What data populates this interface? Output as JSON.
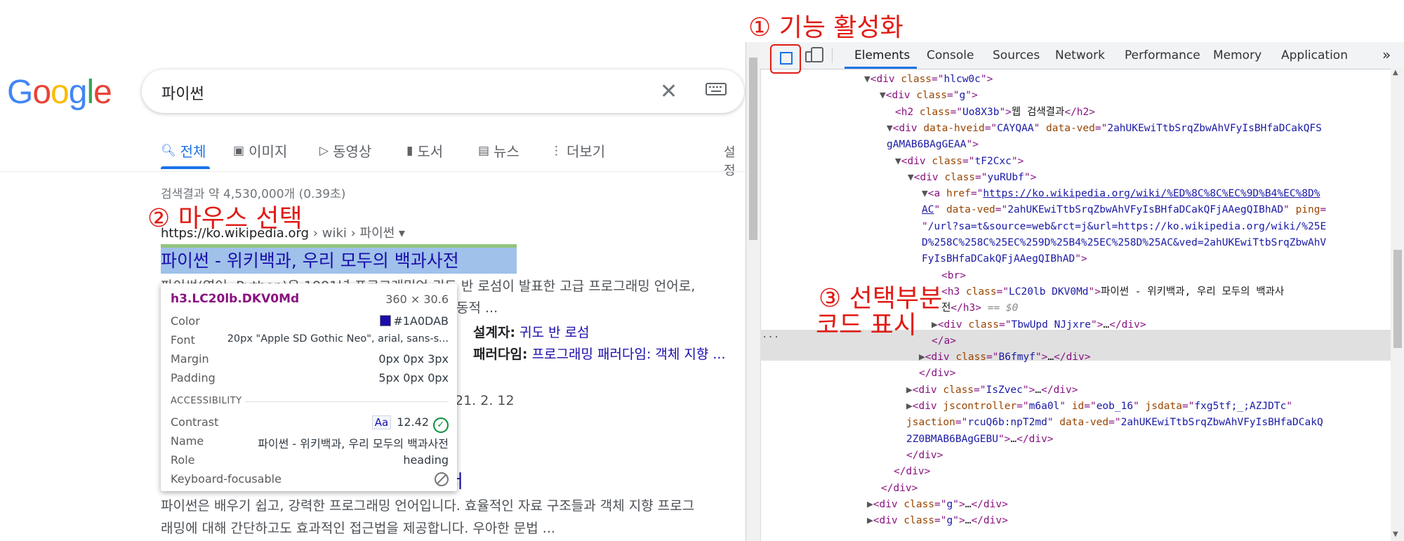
{
  "google": {
    "search_query": "파이썬",
    "tabs": [
      {
        "label": "전체",
        "icon": "search-icon"
      },
      {
        "label": "이미지",
        "icon": "image-icon"
      },
      {
        "label": "동영상",
        "icon": "video-icon"
      },
      {
        "label": "도서",
        "icon": "book-icon"
      },
      {
        "label": "뉴스",
        "icon": "news-icon"
      },
      {
        "label": "더보기",
        "icon": "more-dots-icon"
      }
    ],
    "settings_fragment": "설정",
    "result_stats": "검색결과 약 4,530,000개 (0.39초)",
    "result1": {
      "url_host": "https://ko.wikipedia.org",
      "url_path": " › wiki › 파이썬 ▾",
      "title": "파이썬 - 위키백과, 우리 모두의 백과사전",
      "snippet_l1": "파이썬(영어: Python)은 1991년 프로그래밍언 귀도 반 로섬이 발표한 고급 프로그래밍 언어로,",
      "snippet_l2": "동적 ...",
      "designer_label": "설계자:",
      "designer_value": "귀도 반 로섬",
      "paradigm_label": "패러다임:",
      "paradigm_value": "프로그래밍 패러다임: 객체 지향 ...",
      "date_fragment": "21. 2. 12"
    },
    "result2": {
      "title_fragment": "서",
      "snippet_l1": "파이썬은 배우기 쉽고, 강력한 프로그래밍 언어입니다. 효율적인 자료 구조들과 객체 지향 프로그",
      "snippet_l2": "래밍에 대해 간단하고도 효과적인 접근법을 제공합니다. 우아한 문법 ..."
    }
  },
  "tooltip": {
    "selector": "h3.LC20lb.DKV0Md",
    "size": "360 × 30.6",
    "rows": [
      {
        "key": "Color",
        "value": "#1A0DAB"
      },
      {
        "key": "Font",
        "value": "20px \"Apple SD Gothic Neo\", arial, sans-s..."
      },
      {
        "key": "Margin",
        "value": "0px 0px 3px"
      },
      {
        "key": "Padding",
        "value": "5px 0px 0px"
      }
    ],
    "accessibility_header": "ACCESSIBILITY",
    "acc_rows": [
      {
        "key": "Contrast",
        "value": "12.42"
      },
      {
        "key": "Name",
        "value": "파이썬 - 위키백과, 우리 모두의 백과사전"
      },
      {
        "key": "Role",
        "value": "heading"
      },
      {
        "key": "Keyboard-focusable",
        "value": ""
      }
    ],
    "contrast_badge": "Aa"
  },
  "annotations": {
    "step1": "① 기능 활성화",
    "step2": "② 마우스 선택",
    "step3_line1": "③ 선택부분",
    "step3_line2": "코드 표시"
  },
  "devtools": {
    "tabs": [
      "Elements",
      "Console",
      "Sources",
      "Network",
      "Performance",
      "Memory",
      "Application"
    ],
    "more": "»",
    "code_lines": [
      {
        "indent": 168,
        "parts": [
          [
            "tri",
            "▼"
          ],
          [
            "tag",
            "<div "
          ],
          [
            "an",
            "class"
          ],
          [
            "tag",
            "=\""
          ],
          [
            "av",
            "hlcw0c"
          ],
          [
            "tag",
            "\">"
          ]
        ]
      },
      {
        "indent": 190,
        "parts": [
          [
            "tri",
            "▼"
          ],
          [
            "tag",
            "<div "
          ],
          [
            "an",
            "class"
          ],
          [
            "tag",
            "=\""
          ],
          [
            "av",
            "g"
          ],
          [
            "tag",
            "\">"
          ]
        ]
      },
      {
        "indent": 212,
        "parts": [
          [
            "tag",
            "<h2 "
          ],
          [
            "an",
            "class"
          ],
          [
            "tag",
            "=\""
          ],
          [
            "av",
            "Uo8X3b"
          ],
          [
            "tag",
            "\">"
          ],
          [
            "txt",
            "웹 검색결과"
          ],
          [
            "tag",
            "</h2>"
          ]
        ]
      },
      {
        "indent": 200,
        "parts": [
          [
            "tri",
            "▼"
          ],
          [
            "tag",
            "<div "
          ],
          [
            "an",
            "data-hveid"
          ],
          [
            "tag",
            "=\""
          ],
          [
            "av",
            "CAYQAA"
          ],
          [
            "tag",
            "\" "
          ],
          [
            "an",
            "data-ved"
          ],
          [
            "tag",
            "=\""
          ],
          [
            "av",
            "2ahUKEwiTtbSrqZbwAhVFyIsBHfaDCakQFS"
          ]
        ]
      },
      {
        "indent": 200,
        "parts": [
          [
            "av",
            "gAMAB6BAgGEAA"
          ],
          [
            "tag",
            "\">"
          ]
        ]
      },
      {
        "indent": 212,
        "parts": [
          [
            "tri",
            "▼"
          ],
          [
            "tag",
            "<div "
          ],
          [
            "an",
            "class"
          ],
          [
            "tag",
            "=\""
          ],
          [
            "av",
            "tF2Cxc"
          ],
          [
            "tag",
            "\">"
          ]
        ]
      },
      {
        "indent": 230,
        "parts": [
          [
            "tri",
            "▼"
          ],
          [
            "tag",
            "<div "
          ],
          [
            "an",
            "class"
          ],
          [
            "tag",
            "=\""
          ],
          [
            "av",
            "yuRUbf"
          ],
          [
            "tag",
            "\">"
          ]
        ]
      },
      {
        "indent": 250,
        "parts": [
          [
            "tri",
            "▼"
          ],
          [
            "tag",
            "<a "
          ],
          [
            "an",
            "href"
          ],
          [
            "tag",
            "=\""
          ],
          [
            "avl",
            "https://ko.wikipedia.org/wiki/%ED%8C%8C%EC%9D%B4%EC%8D%"
          ]
        ]
      },
      {
        "indent": 250,
        "parts": [
          [
            "avl",
            "AC"
          ],
          [
            "tag",
            "\" "
          ],
          [
            "an",
            "data-ved"
          ],
          [
            "tag",
            "=\""
          ],
          [
            "av",
            "2ahUKEwiTtbSrqZbwAhVFyIsBHfaDCakQFjAAegQIBhAD"
          ],
          [
            "tag",
            "\" "
          ],
          [
            "an",
            "ping"
          ],
          [
            "tag",
            "="
          ]
        ]
      },
      {
        "indent": 250,
        "parts": [
          [
            "tag",
            "\""
          ],
          [
            "av",
            "/url?sa=t&source=web&rct=j&url=https://ko.wikipedia.org/wiki/%25E"
          ]
        ]
      },
      {
        "indent": 250,
        "parts": [
          [
            "av",
            "D%258C%258C%25EC%259D%25B4%25EC%258D%25AC&ved=2ahUKEwiTtbSrqZbwAhV"
          ]
        ]
      },
      {
        "indent": 250,
        "parts": [
          [
            "av",
            "FyIsBHfaDCakQFjAAegQIBhAD"
          ],
          [
            "tag",
            "\">"
          ]
        ]
      },
      {
        "indent": 278,
        "parts": [
          [
            "tag",
            "<br>"
          ]
        ]
      },
      {
        "indent": 278,
        "parts": [
          [
            "tag",
            "<h3 "
          ],
          [
            "an",
            "class"
          ],
          [
            "tag",
            "=\""
          ],
          [
            "av",
            "LC20lb DKV0Md"
          ],
          [
            "tag",
            "\">"
          ],
          [
            "txt",
            "파이썬 - 위키백과, 우리 모두의 백과사"
          ]
        ]
      },
      {
        "indent": 278,
        "parts": [
          [
            "txt",
            "전"
          ],
          [
            "tag",
            "</h3>"
          ],
          [
            "cm",
            " == $0"
          ]
        ]
      },
      {
        "indent": 264,
        "parts": [
          [
            "tri",
            "▶"
          ],
          [
            "tag",
            "<div "
          ],
          [
            "an",
            "class"
          ],
          [
            "tag",
            "=\""
          ],
          [
            "av",
            "TbwUpd NJjxre"
          ],
          [
            "tag",
            "\">"
          ],
          [
            "txt",
            "…"
          ],
          [
            "tag",
            "</div>"
          ]
        ]
      },
      {
        "indent": 264,
        "parts": [
          [
            "tag",
            "</a>"
          ]
        ]
      },
      {
        "indent": 246,
        "parts": [
          [
            "tri",
            "▶"
          ],
          [
            "tag",
            "<div "
          ],
          [
            "an",
            "class"
          ],
          [
            "tag",
            "=\""
          ],
          [
            "av",
            "B6fmyf"
          ],
          [
            "tag",
            "\">"
          ],
          [
            "txt",
            "…"
          ],
          [
            "tag",
            "</div>"
          ]
        ]
      },
      {
        "indent": 246,
        "parts": [
          [
            "tag",
            "</div>"
          ]
        ]
      },
      {
        "indent": 228,
        "parts": [
          [
            "tri",
            "▶"
          ],
          [
            "tag",
            "<div "
          ],
          [
            "an",
            "class"
          ],
          [
            "tag",
            "=\""
          ],
          [
            "av",
            "IsZvec"
          ],
          [
            "tag",
            "\">"
          ],
          [
            "txt",
            "…"
          ],
          [
            "tag",
            "</div>"
          ]
        ]
      },
      {
        "indent": 228,
        "parts": [
          [
            "tri",
            "▶"
          ],
          [
            "tag",
            "<div "
          ],
          [
            "an",
            "jscontroller"
          ],
          [
            "tag",
            "=\""
          ],
          [
            "av",
            "m6a0l"
          ],
          [
            "tag",
            "\" "
          ],
          [
            "an",
            "id"
          ],
          [
            "tag",
            "=\""
          ],
          [
            "av",
            "eob_16"
          ],
          [
            "tag",
            "\" "
          ],
          [
            "an",
            "jsdata"
          ],
          [
            "tag",
            "=\""
          ],
          [
            "av",
            "fxg5tf;_;AZJDTc"
          ],
          [
            "tag",
            "\""
          ]
        ]
      },
      {
        "indent": 228,
        "parts": [
          [
            "an",
            "jsaction"
          ],
          [
            "tag",
            "=\""
          ],
          [
            "av",
            "rcuQ6b:npT2md"
          ],
          [
            "tag",
            "\" "
          ],
          [
            "an",
            "data-ved"
          ],
          [
            "tag",
            "=\""
          ],
          [
            "av",
            "2ahUKEwiTtbSrqZbwAhVFyIsBHfaDCakQ"
          ]
        ]
      },
      {
        "indent": 228,
        "parts": [
          [
            "av",
            "2Z0BMAB6BAgGEBU"
          ],
          [
            "tag",
            "\">"
          ],
          [
            "txt",
            "…"
          ],
          [
            "tag",
            "</div>"
          ]
        ]
      },
      {
        "indent": 228,
        "parts": [
          [
            "tag",
            "</div>"
          ]
        ]
      },
      {
        "indent": 210,
        "parts": [
          [
            "tag",
            "</div>"
          ]
        ]
      },
      {
        "indent": 192,
        "parts": [
          [
            "tag",
            "</div>"
          ]
        ]
      },
      {
        "indent": 172,
        "parts": [
          [
            "tri",
            "▶"
          ],
          [
            "tag",
            "<div "
          ],
          [
            "an",
            "class"
          ],
          [
            "tag",
            "=\""
          ],
          [
            "av",
            "g"
          ],
          [
            "tag",
            "\">"
          ],
          [
            "txt",
            "…"
          ],
          [
            "tag",
            "</div>"
          ]
        ]
      },
      {
        "indent": 172,
        "parts": [
          [
            "tri",
            "▶"
          ],
          [
            "tag",
            "<div "
          ],
          [
            "an",
            "class"
          ],
          [
            "tag",
            "=\""
          ],
          [
            "av",
            "g"
          ],
          [
            "tag",
            "\">"
          ],
          [
            "txt",
            "…"
          ],
          [
            "tag",
            "</div>"
          ]
        ]
      }
    ]
  },
  "colors": {
    "google_blue": "#4285F4",
    "google_red": "#EA4335",
    "google_yellow": "#FBBC05",
    "google_green": "#34A853",
    "link": "#1a0dab",
    "annotation_red": "#e11b14"
  }
}
